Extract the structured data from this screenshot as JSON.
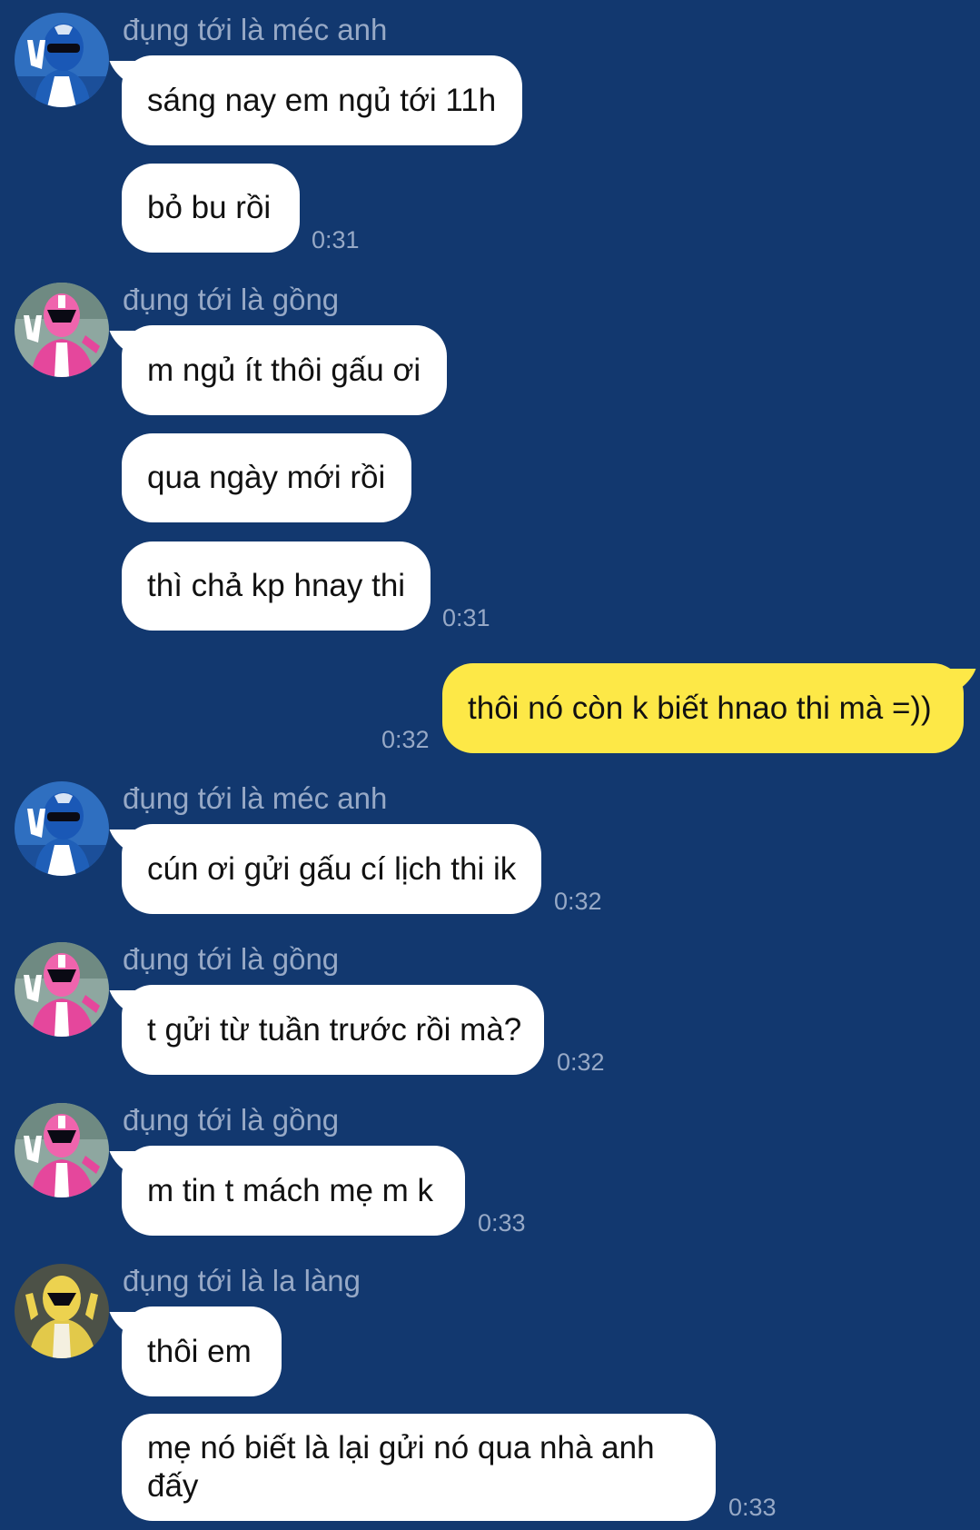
{
  "messages": [
    {
      "sender": "đụng tới là méc anh",
      "texts": [
        "sáng nay em ngủ tới 11h",
        "bỏ bu rồi"
      ],
      "time": "0:31",
      "avatar": "blue-ranger-avatar"
    },
    {
      "sender": "đụng tới là gồng",
      "texts": [
        "m ngủ ít thôi gấu ơi",
        "qua ngày mới rồi",
        "thì chả kp hnay thi"
      ],
      "time": "0:31",
      "avatar": "pink-ranger-avatar"
    },
    {
      "sender": "me",
      "texts": [
        "thôi nó còn k biết hnao thi mà =))"
      ],
      "time": "0:32"
    },
    {
      "sender": "đụng tới là méc anh",
      "texts": [
        "cún ơi gửi gấu cí lịch thi ik"
      ],
      "time": "0:32",
      "avatar": "blue-ranger-avatar"
    },
    {
      "sender": "đụng tới là gồng",
      "texts": [
        "t gửi từ tuần trước rồi mà?"
      ],
      "time": "0:32",
      "avatar": "pink-ranger-avatar"
    },
    {
      "sender": "đụng tới là gồng",
      "texts": [
        "m tin t mách mẹ m k"
      ],
      "time": "0:33",
      "avatar": "pink-ranger-avatar"
    },
    {
      "sender": "đụng tới là la làng",
      "texts": [
        "thôi em",
        "mẹ nó biết là lại gửi nó qua nhà anh đấy"
      ],
      "time": "0:33",
      "avatar": "yellow-ranger-avatar"
    }
  ],
  "colors": {
    "background": "#12386f",
    "incoming_bubble": "#ffffff",
    "outgoing_bubble": "#fde847",
    "meta_text": "#97a9c6"
  }
}
